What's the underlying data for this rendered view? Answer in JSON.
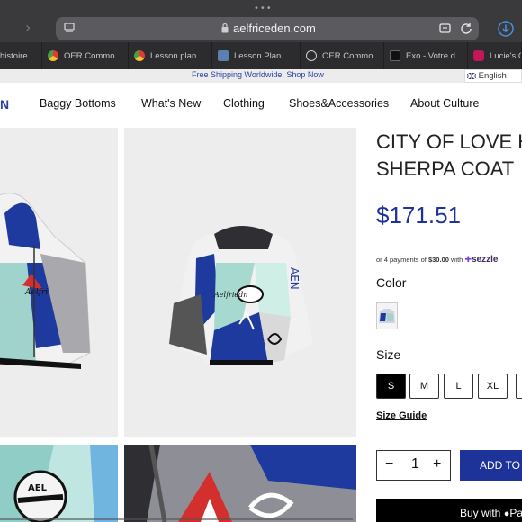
{
  "browser": {
    "url": "aelfriceden.com",
    "tabs": [
      {
        "label": "histoire...",
        "icon": "none",
        "color": "#8a8a8a"
      },
      {
        "label": "OER Commo...",
        "icon": "chrome-icon",
        "color": "#4caf50"
      },
      {
        "label": "Lesson plan...",
        "icon": "chrome-icon",
        "color": "#4caf50"
      },
      {
        "label": "Lesson Plan",
        "icon": "image-icon",
        "color": "#5a7fb0"
      },
      {
        "label": "OER Commo...",
        "icon": "cc-icon",
        "color": "#cccccc"
      },
      {
        "label": "Exo - Votre d...",
        "icon": "exo-icon",
        "color": "#222222"
      },
      {
        "label": "Lucie's C",
        "icon": "app-icon",
        "color": "#c2185b"
      }
    ]
  },
  "promo": {
    "text": "Free Shipping Worldwide! Shop Now"
  },
  "language": {
    "label": "English"
  },
  "nav": {
    "items": [
      "Baggy Bottoms",
      "What's New",
      "Clothing",
      "Shoes&Accessories",
      "About Culture"
    ]
  },
  "product": {
    "title_line1": "CITY OF LOVE H",
    "title_line2": "SHERPA COAT",
    "price": "$171.51",
    "installment_prefix": "or 4 payments of",
    "installment_amount": "$30.00",
    "installment_suffix": "with",
    "payment_brand": "sezzle",
    "color_label": "Color",
    "size_label": "Size",
    "sizes": [
      "S",
      "M",
      "L",
      "XL"
    ],
    "selected_size": "S",
    "size_guide": "Size Guide",
    "quantity": "1",
    "qty_minus": "−",
    "qty_plus": "+",
    "add_to_cart": "ADD TO",
    "buy_with": "Buy with",
    "buy_with_brand": "Pa"
  },
  "colors": {
    "brand_blue": "#1e3399",
    "chrome_dark": "#3a3a3c"
  }
}
